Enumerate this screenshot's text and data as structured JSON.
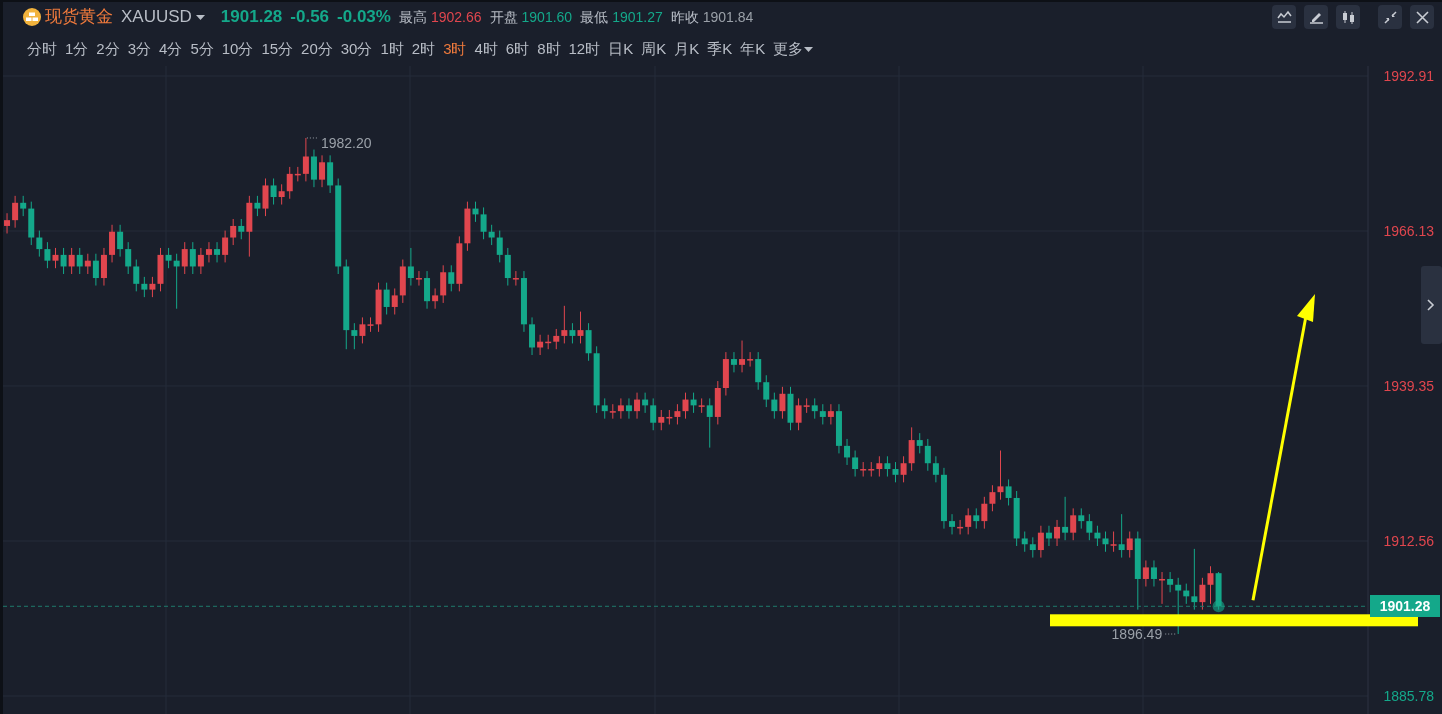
{
  "header": {
    "name": "现货黄金",
    "symbol": "XAUUSD",
    "price": "1901.28",
    "change": "-0.56",
    "change_pct": "-0.03%",
    "stats": [
      {
        "label": "最高",
        "value": "1902.66",
        "color": "#e0464e"
      },
      {
        "label": "开盘",
        "value": "1901.60",
        "color": "#14a88a"
      },
      {
        "label": "最低",
        "value": "1901.27",
        "color": "#14a88a"
      },
      {
        "label": "昨收",
        "value": "1901.84",
        "color": "#9aa0a8"
      }
    ]
  },
  "toolbar": [
    {
      "kind": "indicator"
    },
    {
      "kind": "draw"
    },
    {
      "kind": "candles"
    },
    {
      "kind": "shrink"
    },
    {
      "kind": "close"
    }
  ],
  "timeframes": [
    {
      "label": "分时",
      "selected": false
    },
    {
      "label": "1分",
      "selected": false
    },
    {
      "label": "2分",
      "selected": false
    },
    {
      "label": "3分",
      "selected": false
    },
    {
      "label": "4分",
      "selected": false
    },
    {
      "label": "5分",
      "selected": false
    },
    {
      "label": "10分",
      "selected": false
    },
    {
      "label": "15分",
      "selected": false
    },
    {
      "label": "20分",
      "selected": false
    },
    {
      "label": "30分",
      "selected": false
    },
    {
      "label": "1时",
      "selected": false
    },
    {
      "label": "2时",
      "selected": false
    },
    {
      "label": "3时",
      "selected": true
    },
    {
      "label": "4时",
      "selected": false
    },
    {
      "label": "6时",
      "selected": false
    },
    {
      "label": "8时",
      "selected": false
    },
    {
      "label": "12时",
      "selected": false
    },
    {
      "label": "日K",
      "selected": false
    },
    {
      "label": "周K",
      "selected": false
    },
    {
      "label": "月K",
      "selected": false
    },
    {
      "label": "季K",
      "selected": false
    },
    {
      "label": "年K",
      "selected": false
    },
    {
      "label": "更多",
      "selected": false,
      "kind": "menu"
    }
  ],
  "chart": {
    "high_label": "1982.20",
    "low_label": "1896.49",
    "current_price": "1901.28",
    "chart_data": {
      "type": "candlestick",
      "grid": true,
      "ref_lines": [
        {
          "axis": "y",
          "value": 1901.28
        }
      ],
      "categories": [
        null,
        null,
        null,
        null,
        null,
        null,
        null,
        null,
        null,
        null,
        null,
        null,
        null,
        null,
        null,
        null,
        null,
        null,
        null,
        null,
        null,
        null,
        null,
        null,
        null,
        null,
        null,
        null,
        null,
        null,
        null,
        null,
        null,
        null,
        null,
        null,
        null,
        null,
        null,
        null,
        null,
        null,
        null,
        null,
        null,
        null,
        null,
        null,
        null,
        null,
        null,
        null,
        null,
        null,
        null,
        null,
        null,
        null,
        null,
        null,
        null,
        null,
        null,
        null,
        null,
        null,
        null,
        null,
        null,
        null,
        null,
        null,
        null,
        null,
        null,
        null,
        null,
        null,
        null,
        null,
        null,
        null,
        null,
        null,
        null,
        null,
        null,
        null,
        null,
        null,
        null,
        null,
        null,
        null,
        null,
        null,
        null,
        null,
        null,
        null,
        null,
        null,
        null,
        null,
        null,
        null,
        null,
        null,
        null,
        null,
        null,
        null,
        null,
        null,
        null,
        null,
        null,
        null,
        null,
        null,
        null,
        null,
        null,
        null,
        null,
        null,
        null,
        null,
        null,
        null,
        null,
        null,
        null,
        null,
        null,
        null,
        null,
        null,
        null,
        null,
        null,
        null,
        null,
        null,
        null,
        null,
        null,
        null,
        null,
        null,
        null,
        null,
        null,
        null,
        null,
        null,
        null,
        null,
        null,
        null,
        null,
        null,
        null,
        null,
        null,
        null,
        null,
        null,
        null
      ],
      "ylim": [
        1885.78,
        1992.91
      ],
      "yticks": [
        {
          "value": 1992.91,
          "label": "1992.91"
        },
        {
          "value": 1966.13,
          "label": "1966.13"
        },
        {
          "value": 1939.35,
          "label": "1939.35"
        },
        {
          "value": 1912.56,
          "label": "1912.56"
        },
        {
          "value": 1885.78,
          "label": "1885.78"
        }
      ],
      "ohlc": [
        [
          1967,
          1969.2,
          1965.7,
          1968
        ],
        [
          1968,
          1972.2,
          1966.7,
          1971
        ],
        [
          1971,
          1972.2,
          1968.7,
          1970
        ],
        [
          1970,
          1971.2,
          1963.7,
          1965
        ],
        [
          1965,
          1966.2,
          1961.7,
          1963
        ],
        [
          1963,
          1964.2,
          1959.7,
          1961
        ],
        [
          1961,
          1963.2,
          1959.7,
          1962
        ],
        [
          1962,
          1963.2,
          1958.7,
          1960
        ],
        [
          1960,
          1963.2,
          1958.7,
          1962
        ],
        [
          1962,
          1963.2,
          1958.7,
          1960
        ],
        [
          1960,
          1962.2,
          1958.7,
          1961
        ],
        [
          1961,
          1962.2,
          1956.7,
          1958
        ],
        [
          1958,
          1963.2,
          1956.7,
          1962
        ],
        [
          1962,
          1967.2,
          1960.7,
          1966
        ],
        [
          1966,
          1967.2,
          1961.7,
          1963
        ],
        [
          1963,
          1964.2,
          1958.7,
          1960
        ],
        [
          1960,
          1961.2,
          1955.7,
          1957
        ],
        [
          1957,
          1958.2,
          1954.7,
          1956
        ],
        [
          1956,
          1958.2,
          1954.7,
          1957
        ],
        [
          1957,
          1963.2,
          1955.7,
          1962
        ],
        [
          1962,
          1963.2,
          1959.7,
          1961
        ],
        [
          1961,
          1962.2,
          1952.7,
          1960
        ],
        [
          1960,
          1964.2,
          1958.7,
          1963
        ],
        [
          1963,
          1964.2,
          1958.7,
          1960
        ],
        [
          1960,
          1963.2,
          1958.7,
          1962
        ],
        [
          1962,
          1964.2,
          1960.7,
          1963
        ],
        [
          1963,
          1964.2,
          1960.7,
          1962
        ],
        [
          1962,
          1966.2,
          1960.7,
          1965
        ],
        [
          1965,
          1968.2,
          1963.7,
          1967
        ],
        [
          1967,
          1968.2,
          1964.7,
          1966
        ],
        [
          1966,
          1972.2,
          1961.7,
          1971
        ],
        [
          1971,
          1972.2,
          1968.7,
          1970
        ],
        [
          1970,
          1975.2,
          1968.7,
          1974
        ],
        [
          1974,
          1975.2,
          1970.7,
          1972
        ],
        [
          1972,
          1974.2,
          1970.7,
          1973
        ],
        [
          1973,
          1977.2,
          1971.7,
          1976
        ],
        [
          1976,
          1977.2,
          1974.7,
          1976
        ],
        [
          1976,
          1982.2,
          1974.7,
          1979
        ],
        [
          1979,
          1980.2,
          1973.7,
          1975
        ],
        [
          1975,
          1979.2,
          1973.7,
          1978
        ],
        [
          1978,
          1979.2,
          1972.7,
          1974
        ],
        [
          1974,
          1975.2,
          1958.7,
          1960
        ],
        [
          1960,
          1961.2,
          1945.7,
          1949
        ],
        [
          1949,
          1950.2,
          1945.7,
          1948
        ],
        [
          1948,
          1951.2,
          1946.7,
          1950
        ],
        [
          1950,
          1951.2,
          1948.7,
          1950
        ],
        [
          1950,
          1957.2,
          1948.7,
          1956
        ],
        [
          1956,
          1957.2,
          1951.7,
          1953
        ],
        [
          1953,
          1956.2,
          1951.7,
          1955
        ],
        [
          1955,
          1961.2,
          1953.7,
          1960
        ],
        [
          1960,
          1963.2,
          1956.7,
          1958
        ],
        [
          1958,
          1959.2,
          1956.7,
          1958
        ],
        [
          1958,
          1959.2,
          1952.7,
          1954
        ],
        [
          1954,
          1956.2,
          1952.7,
          1955
        ],
        [
          1955,
          1960.2,
          1953.7,
          1959
        ],
        [
          1959,
          1960.2,
          1955.7,
          1957
        ],
        [
          1957,
          1965.2,
          1955.7,
          1964
        ],
        [
          1964,
          1971.2,
          1962.7,
          1970
        ],
        [
          1970,
          1971.2,
          1967.7,
          1969
        ],
        [
          1969,
          1970.2,
          1964.7,
          1966
        ],
        [
          1966,
          1967.2,
          1963.7,
          1965
        ],
        [
          1965,
          1966.2,
          1960.7,
          1962
        ],
        [
          1962,
          1963.2,
          1956.7,
          1958
        ],
        [
          1958,
          1959.2,
          1956.7,
          1958
        ],
        [
          1958,
          1959.2,
          1948.7,
          1950
        ],
        [
          1950,
          1951.2,
          1944.7,
          1946
        ],
        [
          1946,
          1948.2,
          1944.7,
          1947
        ],
        [
          1947,
          1948.2,
          1945.7,
          1947
        ],
        [
          1947,
          1949.2,
          1945.7,
          1948
        ],
        [
          1948,
          1953.2,
          1946.7,
          1949
        ],
        [
          1949,
          1950.2,
          1946.7,
          1948
        ],
        [
          1948,
          1952.2,
          1946.7,
          1949
        ],
        [
          1949,
          1950.2,
          1943.7,
          1945
        ],
        [
          1945,
          1946.2,
          1934.7,
          1936
        ],
        [
          1936,
          1937.2,
          1933.7,
          1935
        ],
        [
          1935,
          1936.2,
          1933.7,
          1935
        ],
        [
          1935,
          1937.2,
          1933.7,
          1936
        ],
        [
          1936,
          1937.2,
          1933.7,
          1935
        ],
        [
          1935,
          1938.2,
          1933.7,
          1937
        ],
        [
          1937,
          1938.2,
          1934.7,
          1936
        ],
        [
          1936,
          1937.2,
          1931.7,
          1933
        ],
        [
          1933,
          1935.2,
          1931.7,
          1934
        ],
        [
          1934,
          1935.2,
          1932.7,
          1934
        ],
        [
          1934,
          1936.2,
          1932.7,
          1935
        ],
        [
          1935,
          1938.2,
          1933.7,
          1937
        ],
        [
          1937,
          1938.2,
          1934.7,
          1936
        ],
        [
          1936,
          1937.2,
          1934.7,
          1936
        ],
        [
          1936,
          1937.2,
          1928.7,
          1934
        ],
        [
          1934,
          1940.2,
          1932.7,
          1939
        ],
        [
          1939,
          1945.2,
          1937.7,
          1944
        ],
        [
          1944,
          1945.2,
          1941.7,
          1943
        ],
        [
          1943,
          1947.2,
          1941.7,
          1944
        ],
        [
          1944,
          1945.2,
          1942.7,
          1944
        ],
        [
          1944,
          1945.2,
          1938.7,
          1940
        ],
        [
          1940,
          1941.2,
          1935.7,
          1937
        ],
        [
          1937,
          1938.2,
          1933.7,
          1935
        ],
        [
          1935,
          1939.2,
          1933.7,
          1938
        ],
        [
          1938,
          1939.2,
          1931.7,
          1933
        ],
        [
          1933,
          1937.2,
          1931.7,
          1936
        ],
        [
          1936,
          1937.2,
          1934.7,
          1936
        ],
        [
          1936,
          1937.2,
          1933.7,
          1935
        ],
        [
          1935,
          1936.2,
          1932.7,
          1934
        ],
        [
          1934,
          1936.2,
          1932.7,
          1935
        ],
        [
          1935,
          1936.2,
          1927.7,
          1929
        ],
        [
          1929,
          1930.2,
          1925.7,
          1927
        ],
        [
          1927,
          1928.2,
          1923.7,
          1925
        ],
        [
          1925,
          1926.2,
          1923.7,
          1925
        ],
        [
          1925,
          1926.2,
          1923.7,
          1925
        ],
        [
          1925,
          1927.2,
          1923.7,
          1926
        ],
        [
          1926,
          1927.2,
          1923.7,
          1925
        ],
        [
          1925,
          1926.2,
          1922.7,
          1924
        ],
        [
          1924,
          1927.2,
          1922.7,
          1926
        ],
        [
          1926,
          1932.2,
          1924.7,
          1930
        ],
        [
          1930,
          1931.2,
          1927.7,
          1929
        ],
        [
          1929,
          1930.2,
          1924.7,
          1926
        ],
        [
          1926,
          1927.2,
          1922.7,
          1924
        ],
        [
          1924,
          1925.2,
          1914.7,
          1916
        ],
        [
          1916,
          1917.2,
          1913.7,
          1915
        ],
        [
          1915,
          1916.2,
          1913.7,
          1915
        ],
        [
          1915,
          1918.2,
          1913.7,
          1917
        ],
        [
          1917,
          1918.2,
          1914.7,
          1916
        ],
        [
          1916,
          1920.2,
          1914.7,
          1919
        ],
        [
          1919,
          1922.2,
          1917.7,
          1921
        ],
        [
          1921,
          1928.2,
          1919.7,
          1922
        ],
        [
          1922,
          1923.2,
          1918.7,
          1920
        ],
        [
          1920,
          1921.2,
          1911.7,
          1913
        ],
        [
          1913,
          1914.2,
          1910.7,
          1912
        ],
        [
          1912,
          1913.2,
          1909.7,
          1911
        ],
        [
          1911,
          1915.2,
          1909.7,
          1914
        ],
        [
          1914,
          1915.2,
          1911.7,
          1913
        ],
        [
          1913,
          1916.2,
          1911.7,
          1915
        ],
        [
          1915,
          1920.2,
          1912.7,
          1914
        ],
        [
          1914,
          1918.2,
          1912.7,
          1917
        ],
        [
          1917,
          1918.2,
          1914.7,
          1916
        ],
        [
          1916,
          1917.2,
          1912.7,
          1914
        ],
        [
          1914,
          1915.2,
          1911.7,
          1913
        ],
        [
          1913,
          1914.2,
          1910.7,
          1912
        ],
        [
          1912,
          1914.2,
          1910.7,
          1912
        ],
        [
          1912,
          1917.2,
          1909.7,
          1911
        ],
        [
          1911,
          1914.2,
          1909.7,
          1913
        ],
        [
          1913,
          1914.2,
          1900.7,
          1906
        ],
        [
          1906,
          1909.2,
          1904.7,
          1908
        ],
        [
          1908,
          1909.2,
          1904.7,
          1906
        ],
        [
          1906,
          1907.2,
          1901.7,
          1906
        ],
        [
          1906,
          1907.2,
          1903.7,
          1905
        ],
        [
          1905,
          1906.2,
          1896.49,
          1904
        ],
        [
          1904,
          1905.2,
          1901.7,
          1903
        ],
        [
          1903,
          1911.2,
          1900.7,
          1902
        ],
        [
          1902,
          1906.2,
          1900.7,
          1905
        ],
        [
          1905,
          1908.2,
          1901.7,
          1907
        ],
        [
          1907,
          1907.2,
          1900.7,
          1901.28
        ],
        null,
        null,
        null,
        null,
        null,
        null,
        null,
        null,
        null,
        null,
        null,
        null,
        null,
        null,
        null,
        null,
        null,
        null
      ]
    }
  }
}
